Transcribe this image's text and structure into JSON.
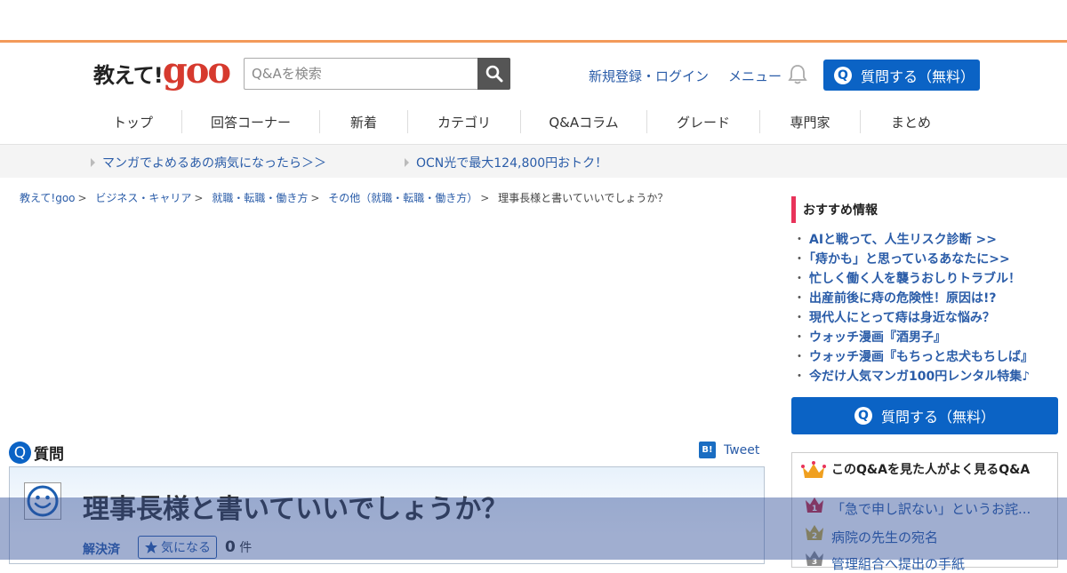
{
  "header": {
    "logo_jp": "教えて!",
    "logo_goo": "goo",
    "search_placeholder": "Q&Aを検索",
    "links": [
      "新規登録・ログイン",
      "メニュー"
    ],
    "ask_label": "質問する（無料）",
    "ask_icon": "Q"
  },
  "nav": [
    "トップ",
    "回答コーナー",
    "新着",
    "カテゴリ",
    "Q&Aコラム",
    "グレード",
    "専門家",
    "まとめ"
  ],
  "promo": [
    "マンガでよめるあの病気になったら＞＞",
    "OCN光で最大124,800円おトク！"
  ],
  "breadcrumb": {
    "items": [
      "教えて!goo",
      "ビジネス・キャリア",
      "就職・転職・働き方",
      "その他（就職・転職・働き方）"
    ],
    "sep": ">",
    "current": "理事長様と書いていいでしょうか？"
  },
  "question": {
    "section_label": "質問",
    "section_icon": "Q",
    "hatena": "B!",
    "tweet": "Tweet",
    "title": "理事長様と書いていいでしょうか？",
    "status": "解決済",
    "kininaru": "気になる",
    "count": "0",
    "count_unit": "件"
  },
  "sidebar": {
    "title": "おすすめ情報",
    "dot": "・",
    "items": [
      "AIと戦って、人生リスク診断 >>",
      "「痔かも」と思っているあなたに>>",
      "忙しく働く人を襲うおしりトラブル！",
      "出産前後に痔の危険性！原因は!?",
      "現代人にとって痔は身近な悩み？",
      "ウォッチ漫画『酒男子』",
      "ウォッチ漫画『もちっと忠犬もちしば』",
      "今だけ人気マンガ100円レンタル特集♪"
    ],
    "ask_label": "質問する（無料）",
    "ask_icon": "Q",
    "popular_title": "このQ&Aを見た人がよく見るQ&A",
    "popular": [
      "「急で申し訳ない」というお詫...",
      "病院の先生の宛名",
      "管理組合へ提出の手紙"
    ],
    "ranks": [
      "1",
      "2",
      "3"
    ]
  },
  "colors": {
    "accent_orange": "#f39a5a",
    "primary_blue": "#0b63c5",
    "link_blue": "#2a5ca8",
    "logo_red": "#d63a2e",
    "sidebar_pink": "#e8335a"
  }
}
